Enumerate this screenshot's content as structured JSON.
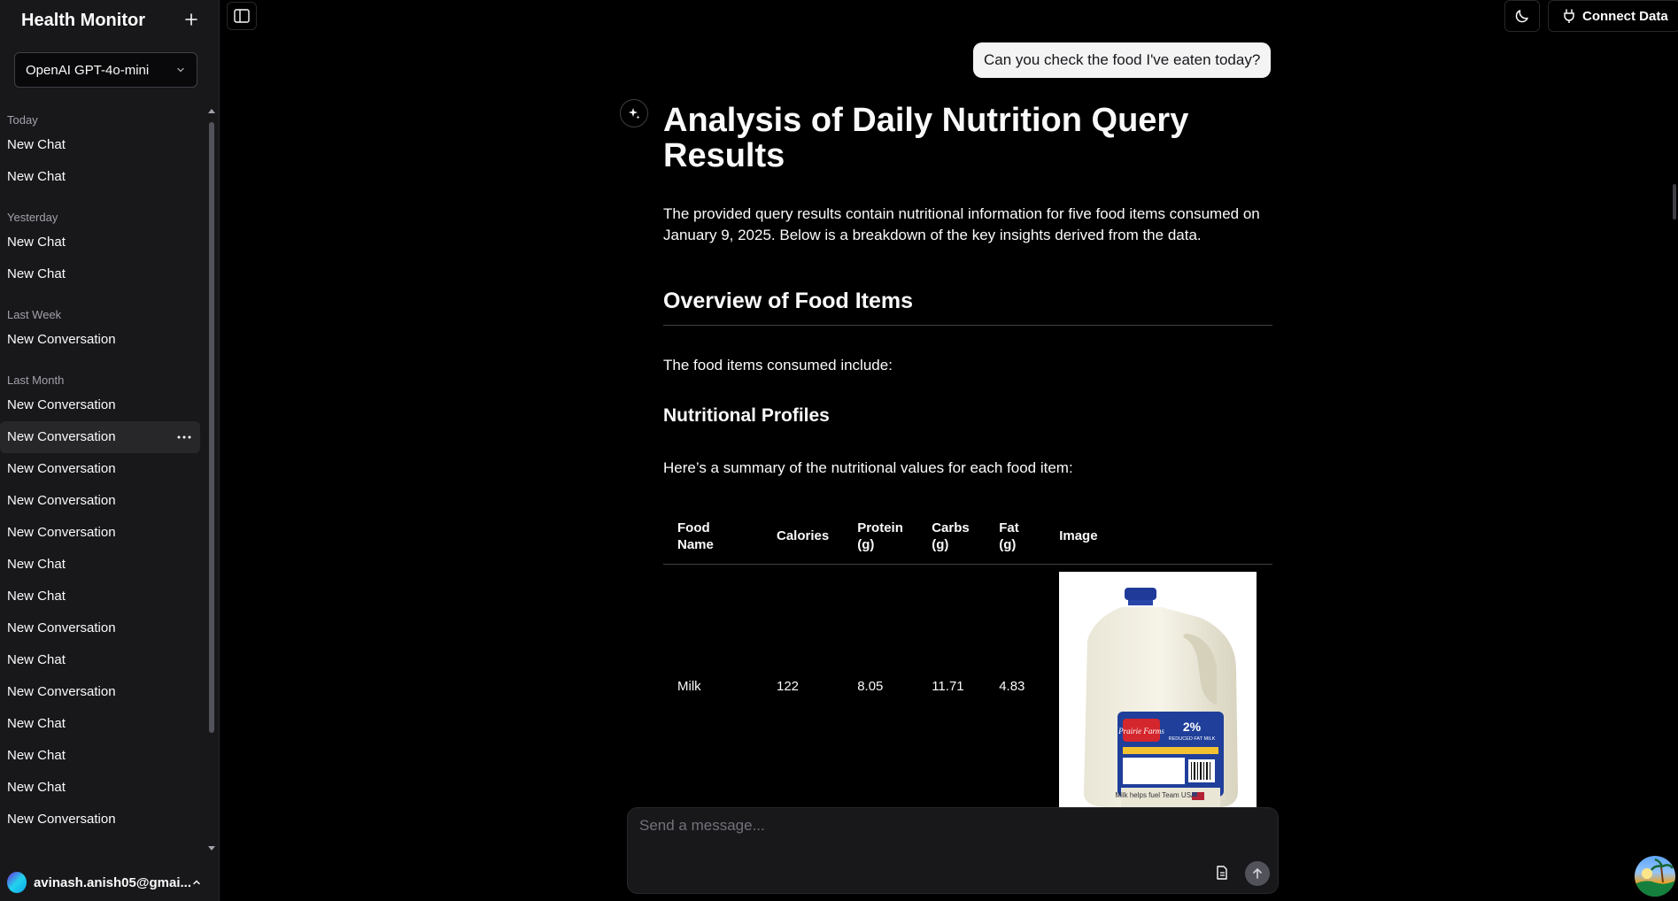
{
  "app": {
    "title": "Health Monitor",
    "model": "OpenAI GPT-4o-mini"
  },
  "sidebar": {
    "groups": [
      {
        "label": "Today",
        "items": [
          "New Chat",
          "New Chat"
        ]
      },
      {
        "label": "Yesterday",
        "items": [
          "New Chat",
          "New Chat"
        ]
      },
      {
        "label": "Last Week",
        "items": [
          "New Conversation"
        ]
      },
      {
        "label": "Last Month",
        "items": [
          "New Conversation",
          "New Conversation",
          "New Conversation",
          "New Conversation",
          "New Conversation",
          "New Chat",
          "New Chat",
          "New Conversation",
          "New Chat",
          "New Conversation",
          "New Chat",
          "New Chat",
          "New Chat",
          "New Conversation"
        ]
      }
    ],
    "user_email": "avinash.anish05@gmai..."
  },
  "topbar": {
    "connect_label": "Connect Data"
  },
  "conversation": {
    "user_message": "Can you check the food I've eaten today?",
    "title": "Analysis of Daily Nutrition Query Results",
    "intro": "The provided query results contain nutritional information for five food items consumed on January 9, 2025. Below is a breakdown of the key insights derived from the data.",
    "overview_heading": "Overview of Food Items",
    "overview_text": "The food items consumed include:",
    "profiles_heading": "Nutritional Profiles",
    "profiles_text": "Here’s a summary of the nutritional values for each food item:",
    "table": {
      "headers": [
        "Food Name",
        "Calories",
        "Protein (g)",
        "Carbs (g)",
        "Fat (g)",
        "Image"
      ],
      "rows": [
        {
          "food": "Milk",
          "calories": "122",
          "protein": "8.05",
          "carbs": "11.71",
          "fat": "4.83"
        }
      ]
    },
    "milk_label": {
      "brand": "Prairie Farms",
      "percent": "2%",
      "type": "REDUCED FAT MILK",
      "slogan": "Milk helps fuel Team USA."
    }
  },
  "composer": {
    "placeholder": "Send a message..."
  }
}
